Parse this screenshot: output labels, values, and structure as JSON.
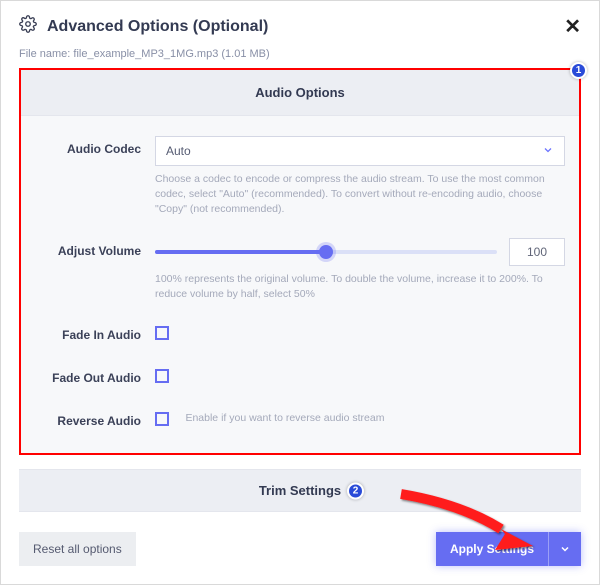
{
  "header": {
    "title": "Advanced Options (Optional)"
  },
  "file": {
    "label": "File name: ",
    "name": "file_example_MP3_1MG.mp3 (1.01 MB)"
  },
  "audio_options": {
    "title": "Audio Options",
    "codec": {
      "label": "Audio Codec",
      "value": "Auto",
      "helper": "Choose a codec to encode or compress the audio stream. To use the most common codec, select \"Auto\" (recommended). To convert without re-encoding audio, choose \"Copy\" (not recommended)."
    },
    "volume": {
      "label": "Adjust Volume",
      "value": "100",
      "percent": 50,
      "helper": "100% represents the original volume. To double the volume, increase it to 200%. To reduce volume by half, select 50%"
    },
    "fade_in": {
      "label": "Fade In Audio"
    },
    "fade_out": {
      "label": "Fade Out Audio"
    },
    "reverse": {
      "label": "Reverse Audio",
      "helper": "Enable if you want to reverse audio stream"
    }
  },
  "trim": {
    "title": "Trim Settings"
  },
  "footer": {
    "reset": "Reset all options",
    "apply": "Apply Settings"
  },
  "badges": {
    "one": "1",
    "two": "2"
  }
}
